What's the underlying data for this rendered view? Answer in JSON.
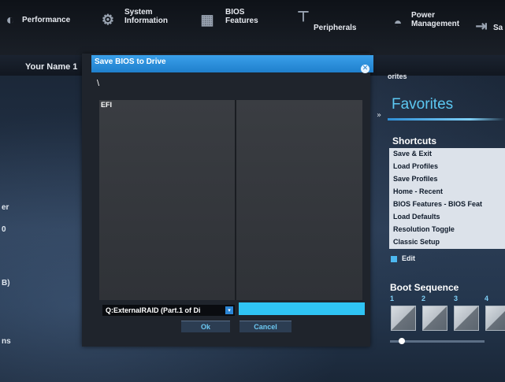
{
  "topnav": [
    {
      "label": "Performance",
      "icon": "speedometer-icon"
    },
    {
      "label": "System\nInformation",
      "icon": "gear-icon"
    },
    {
      "label": "BIOS\nFeatures",
      "icon": "chip-icon"
    },
    {
      "label": "Peripherals",
      "icon": "peripherals-icon"
    },
    {
      "label": "Power\nManagement",
      "icon": "power-icon"
    },
    {
      "label": "Sa",
      "icon": "save-exit-icon"
    }
  ],
  "subbar": {
    "user_name": "Your Name 1",
    "favorites_tab": "orites"
  },
  "left_fragments": [
    "er",
    "0",
    "B)",
    "ns"
  ],
  "dialog": {
    "title": "Save BIOS to Drive",
    "path": "\\",
    "entries": [
      "EFI"
    ],
    "drive": "Q:ExternalRAID (Part.1 of Di",
    "filename": "",
    "ok_label": "Ok",
    "cancel_label": "Cancel"
  },
  "favorites": {
    "title": "Favorites",
    "shortcuts_title": "Shortcuts",
    "shortcuts": [
      "Save & Exit",
      "Load Profiles",
      "Save Profiles",
      "Home - Recent",
      "BIOS Features - BIOS Feat",
      "Load Defaults",
      "Resolution Toggle",
      "Classic Setup"
    ],
    "edit_label": "Edit",
    "boot_title": "Boot Sequence",
    "boot_numbers": [
      "1",
      "2",
      "3",
      "4"
    ]
  },
  "colors": {
    "accent": "#2fc4f4",
    "title_bar": "#2a8fdc",
    "favorites_title": "#5cc8f2"
  }
}
